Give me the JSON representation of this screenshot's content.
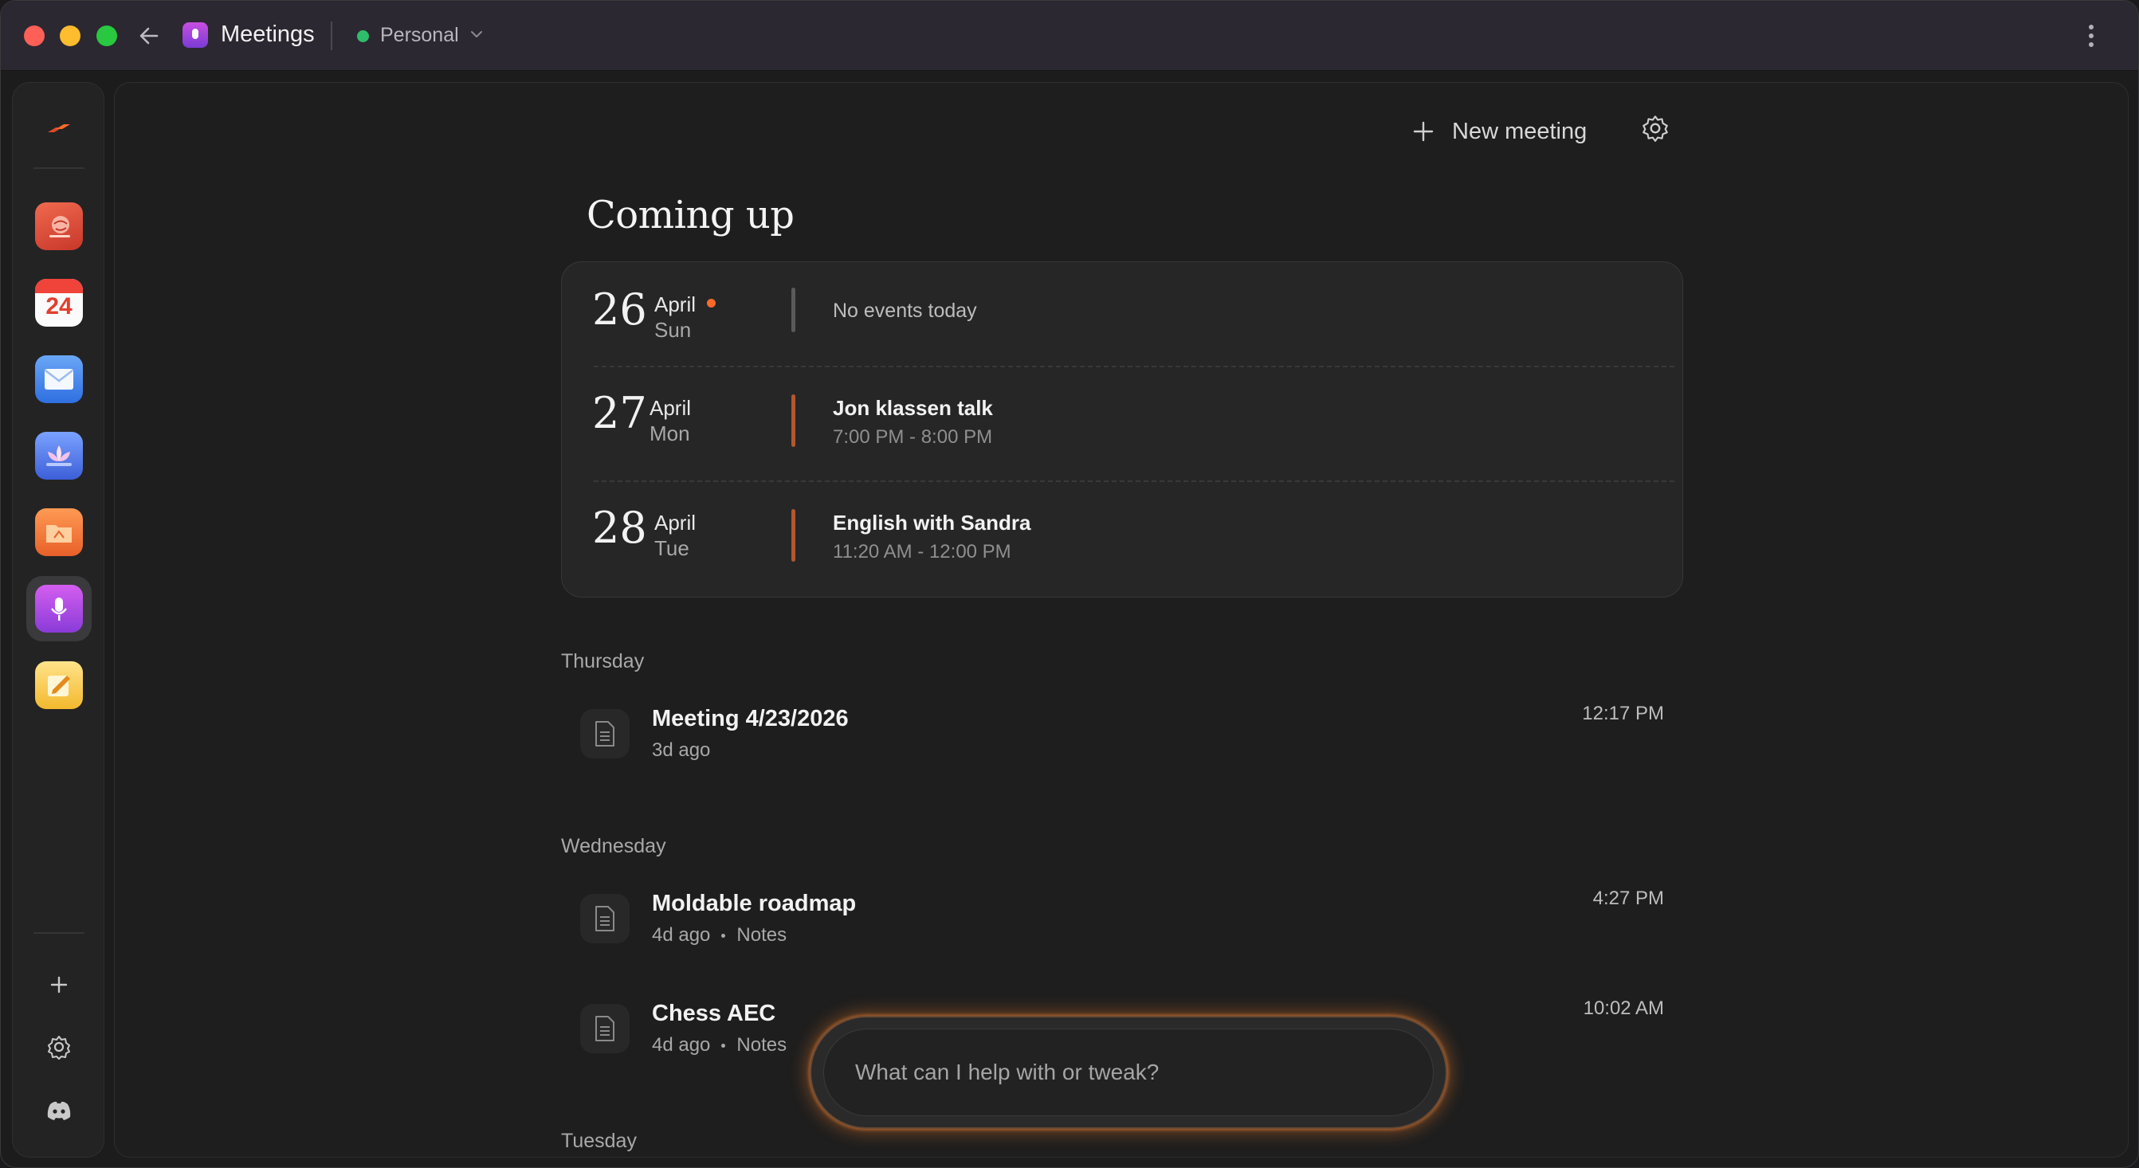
{
  "window": {
    "title": "Meetings",
    "workspace": "Personal"
  },
  "dock": {
    "apps": [
      {
        "name": "globe-book-app",
        "color": "#e8533d"
      },
      {
        "name": "calendar-app",
        "color": "#f4f4f4",
        "label": "24"
      },
      {
        "name": "mail-app",
        "color": "#4d8ff0"
      },
      {
        "name": "lotus-app",
        "color": "#5a7ef0"
      },
      {
        "name": "folder-app",
        "color": "#f07a3a"
      },
      {
        "name": "meetings-app",
        "color": "#b24de6",
        "active": true
      },
      {
        "name": "notes-app",
        "color": "#f7c948"
      }
    ]
  },
  "toolbar": {
    "new_meeting_label": "New meeting"
  },
  "page": {
    "heading": "Coming up"
  },
  "upcoming": [
    {
      "day": "26",
      "month": "April",
      "weekday": "Sun",
      "today": true,
      "empty_text": "No events today"
    },
    {
      "day": "27",
      "month": "April",
      "weekday": "Mon",
      "event_title": "Jon klassen talk",
      "event_time": "7:00 PM - 8:00 PM"
    },
    {
      "day": "28",
      "month": "April",
      "weekday": "Tue",
      "event_title": "English with Sandra",
      "event_time": "11:20 AM - 12:00 PM"
    }
  ],
  "sections": [
    {
      "label": "Thursday",
      "meetings": [
        {
          "title": "Meeting 4/23/2026",
          "ago": "3d ago",
          "time": "12:17 PM"
        }
      ]
    },
    {
      "label": "Wednesday",
      "meetings": [
        {
          "title": "Moldable roadmap",
          "ago": "4d ago",
          "tag": "Notes",
          "time": "4:27 PM"
        },
        {
          "title": "Chess AEC",
          "ago": "4d ago",
          "tag": "Notes",
          "time": "10:02 AM"
        }
      ]
    },
    {
      "label": "Tuesday",
      "meetings": []
    }
  ],
  "chat": {
    "placeholder": "What can I help with or tweak?"
  },
  "colors": {
    "accent": "#ff6a2b",
    "event_bar": "#b4562e",
    "empty_bar": "#5a5a5a",
    "status_dot": "#2fbd6a"
  }
}
